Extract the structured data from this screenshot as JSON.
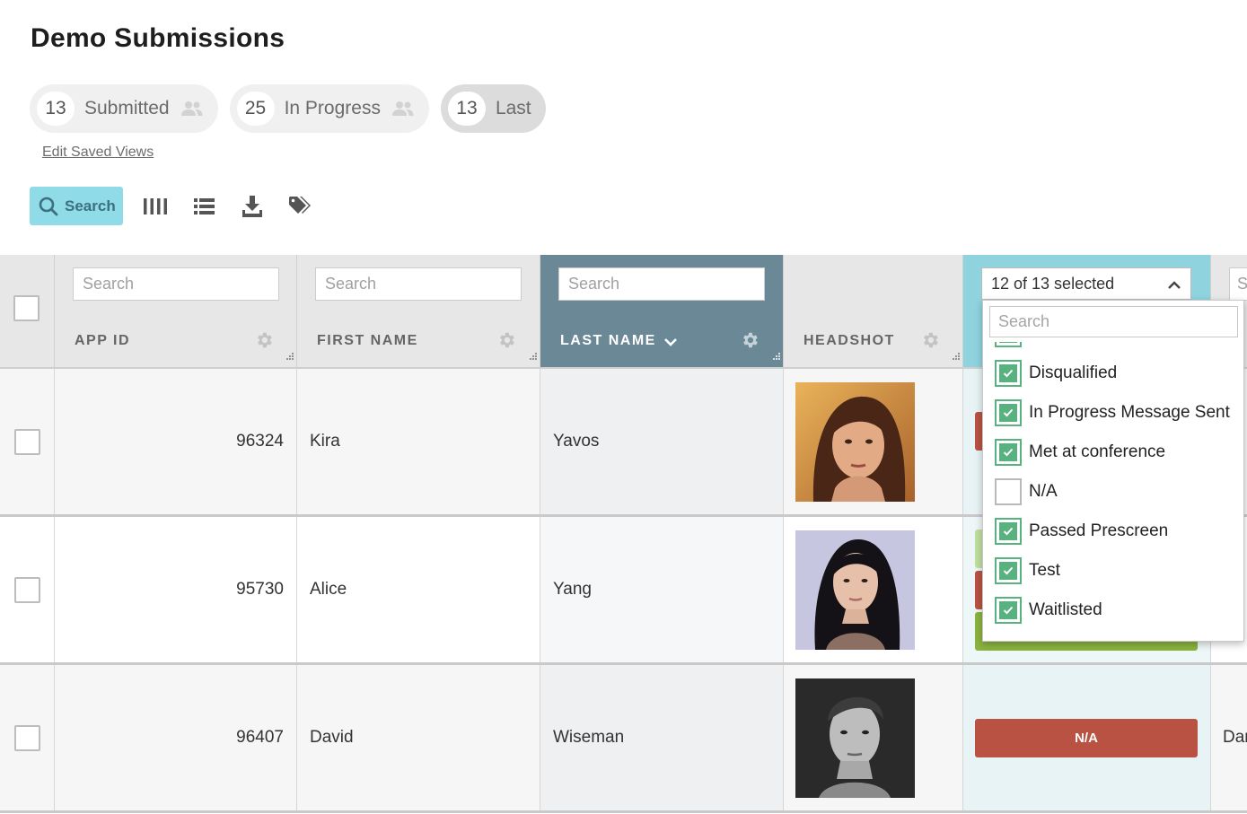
{
  "page": {
    "title": "Demo Submissions"
  },
  "saved_views": [
    {
      "count": "13",
      "label": "Submitted",
      "icon": "users-icon",
      "active": false
    },
    {
      "count": "25",
      "label": "In Progress",
      "icon": "users-icon",
      "active": false
    },
    {
      "count": "13",
      "label": "Last",
      "icon": "",
      "active": true
    }
  ],
  "edit_saved_views": "Edit Saved Views",
  "toolbar": {
    "search_label": "Search",
    "icons": [
      "columns-icon",
      "list-icon",
      "download-icon",
      "tags-icon"
    ]
  },
  "columns": [
    {
      "key": "app_id",
      "label": "APP ID",
      "search_placeholder": "Search"
    },
    {
      "key": "first_name",
      "label": "FIRST NAME",
      "search_placeholder": "Search"
    },
    {
      "key": "last_name",
      "label": "LAST NAME",
      "search_placeholder": "Search",
      "sorted": "desc"
    },
    {
      "key": "headshot",
      "label": "HEADSHOT"
    },
    {
      "key": "status",
      "filter_summary": "12 of 13 selected"
    },
    {
      "key": "next",
      "search_placeholder": "S"
    }
  ],
  "rows": [
    {
      "app_id": "96324",
      "first_name": "Kira",
      "last_name": "Yavos",
      "next_partial": ""
    },
    {
      "app_id": "95730",
      "first_name": "Alice",
      "last_name": "Yang",
      "next_partial": ""
    },
    {
      "app_id": "96407",
      "first_name": "David",
      "last_name": "Wiseman",
      "status_label": "N/A",
      "next_partial": "Dar"
    }
  ],
  "status_filter": {
    "search_placeholder": "Search",
    "options": [
      {
        "label": "Disqualified",
        "checked": true
      },
      {
        "label": "In Progress Message Sent",
        "checked": true
      },
      {
        "label": "Met at conference",
        "checked": true
      },
      {
        "label": "N/A",
        "checked": false
      },
      {
        "label": "Passed Prescreen",
        "checked": true
      },
      {
        "label": "Test",
        "checked": true
      },
      {
        "label": "Waitlisted",
        "checked": true
      }
    ]
  },
  "colors": {
    "accent": "#8fdbe7",
    "sorted_header": "#6b8897",
    "filtered_header": "#8fd3df",
    "status_red": "#b95243",
    "status_green": "#8bb33f",
    "status_light_green": "#bfe0a0",
    "check_green": "#57b27f"
  }
}
